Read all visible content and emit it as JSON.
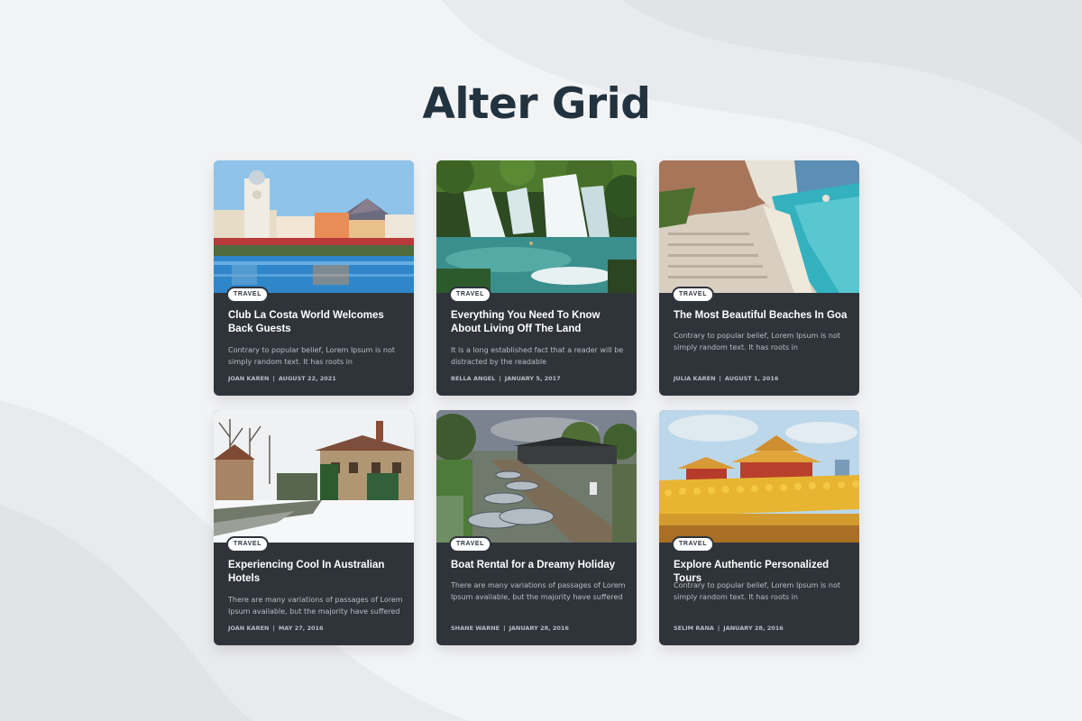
{
  "page": {
    "title": "Alter Grid"
  },
  "cards": [
    {
      "category": "TRAVEL",
      "title": "Club La Costa World Welcomes Back Guests",
      "excerpt": "Contrary to popular belief, Lorem Ipsum is not simply random text. It has roots in",
      "author": "JOAN KAREN",
      "date": "AUGUST 22, 2021",
      "image": "resort-pool-icon"
    },
    {
      "category": "TRAVEL",
      "title": "Everything You Need To Know About Living Off The Land",
      "excerpt": "It is a long established fact that a reader will be distracted by the readable",
      "author": "BELLA ANGEL",
      "date": "JANUARY 5, 2017",
      "image": "waterfall-icon"
    },
    {
      "category": "TRAVEL",
      "title": "The Most Beautiful Beaches In Goa",
      "excerpt": "Contrary to popular belief, Lorem Ipsum is not simply random text. It has roots in",
      "author": "JULIA KAREN",
      "date": "AUGUST 1, 2016",
      "image": "beach-icon"
    },
    {
      "category": "TRAVEL",
      "title": "Experiencing Cool In Australian Hotels",
      "excerpt": "There are many variations of passages of Lorem Ipsum available, but the majority have suffered",
      "author": "JOAN KAREN",
      "date": "MAY 27, 2016",
      "image": "snowy-manor-icon"
    },
    {
      "category": "TRAVEL",
      "title": "Boat Rental for a Dreamy Holiday",
      "excerpt": "There are many variations of passages of Lorem Ipsum available, but the majority have suffered",
      "author": "SHANE WARNE",
      "date": "JANUARY 28, 2016",
      "image": "boats-icon"
    },
    {
      "category": "TRAVEL",
      "title": "Explore Authentic Personalized Tours",
      "excerpt": "Contrary to popular belief, Lorem Ipsum is not simply random text. It has roots in",
      "author": "SELIM RANA",
      "date": "JANUARY 28, 2016",
      "image": "temple-icon"
    }
  ],
  "colors": {
    "background": "#f2f3f5",
    "title": "#23323f",
    "card": "#2f343b",
    "card_text_muted": "#b8bdc4"
  }
}
